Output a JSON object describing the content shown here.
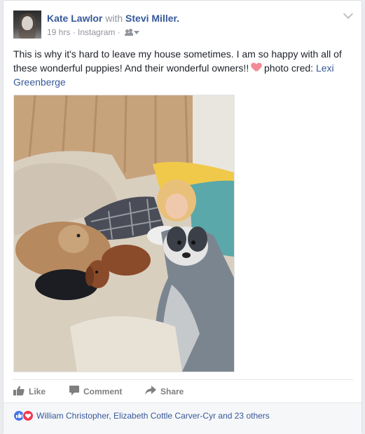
{
  "post": {
    "author": "Kate Lawlor",
    "with_word": "with",
    "tagged": "Stevi Miller.",
    "time": "19 hrs",
    "separator": " · ",
    "source": "Instagram",
    "audience_icon": "friends-icon",
    "menu_icon": "chevron-down-icon",
    "text_main": "This is why it's hard to leave my house sometimes. I am so happy with all of these wonderful puppies! And their wonderful owners!!",
    "text_credit": " photo cred: ",
    "credit_name": "Lexi Greenberge",
    "emoji": "heart-emoji"
  },
  "actions": {
    "like": "Like",
    "comment": "Comment",
    "share": "Share"
  },
  "reactions": {
    "icons": [
      "like-reaction-icon",
      "love-reaction-icon"
    ],
    "names": "William Christopher, Elizabeth Cottle Carver-Cyr and 23 others"
  },
  "colors": {
    "link": "#365899",
    "meta": "#90949c",
    "action": "#7f7f7f",
    "like_blue": "#4a76e8",
    "love_red": "#f0374d"
  }
}
